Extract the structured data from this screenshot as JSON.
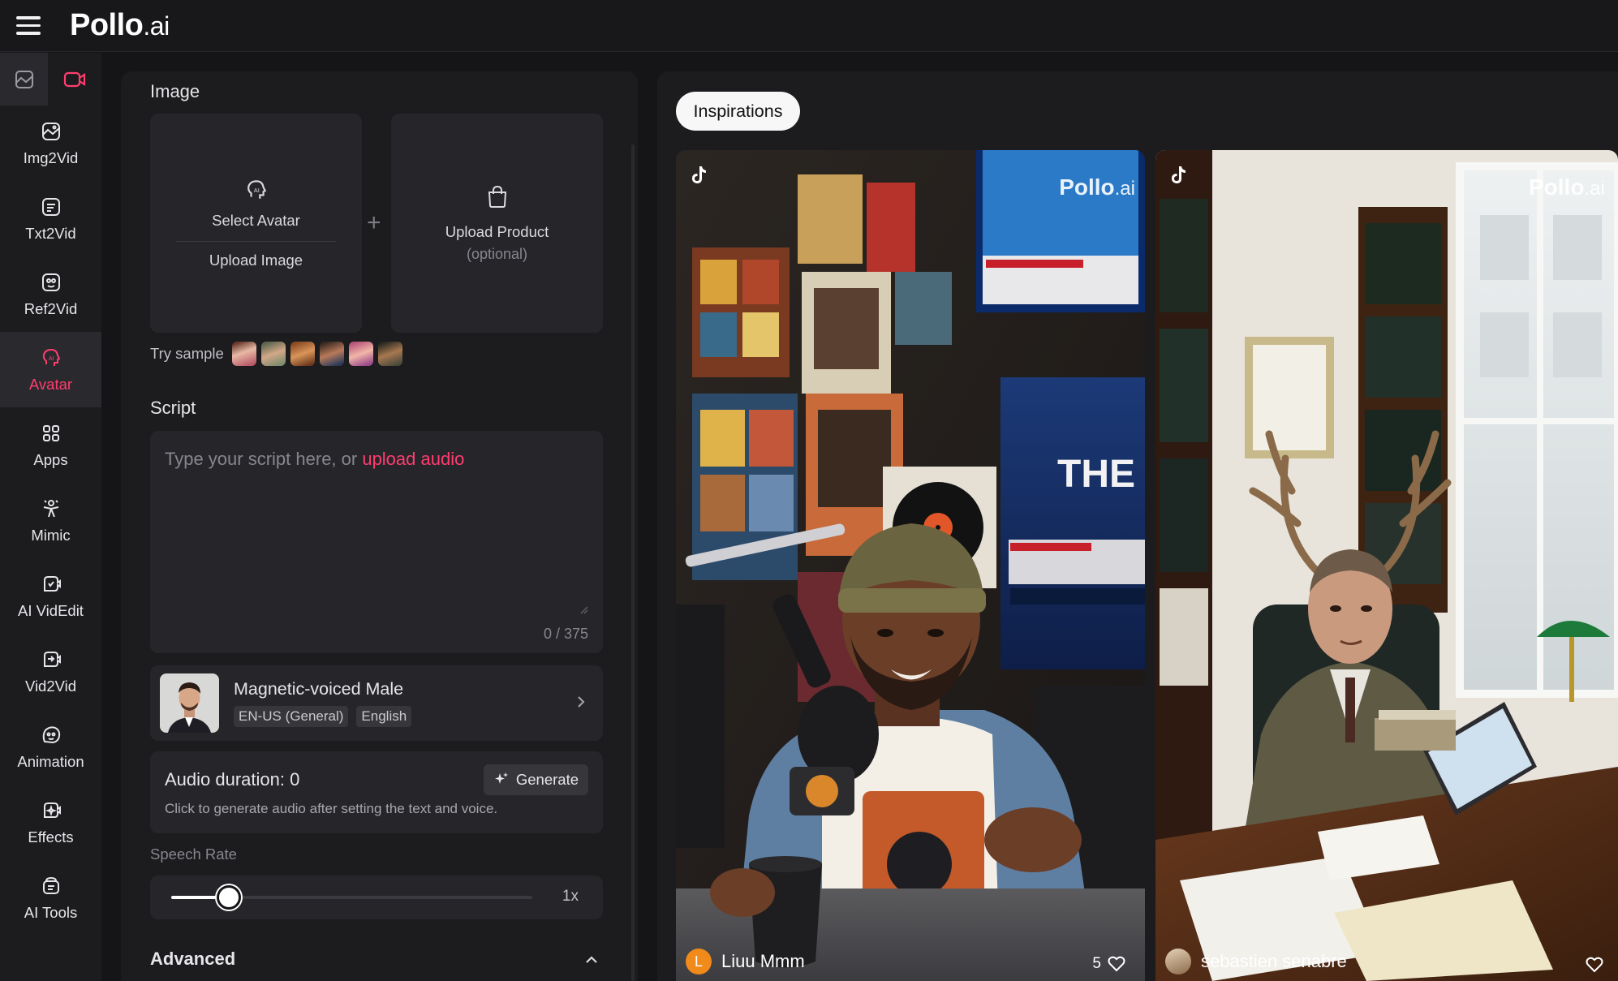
{
  "header": {
    "logo_main": "Pollo",
    "logo_suffix": ".ai"
  },
  "sidebar": {
    "items": [
      {
        "label": "Img2Vid",
        "icon": "image-to-video-icon"
      },
      {
        "label": "Txt2Vid",
        "icon": "text-to-video-icon"
      },
      {
        "label": "Ref2Vid",
        "icon": "reference-to-video-icon"
      },
      {
        "label": "Avatar",
        "icon": "avatar-icon",
        "active": true
      },
      {
        "label": "Apps",
        "icon": "apps-icon"
      },
      {
        "label": "Mimic",
        "icon": "mimic-icon"
      },
      {
        "label": "AI VidEdit",
        "icon": "video-edit-icon"
      },
      {
        "label": "Vid2Vid",
        "icon": "video-to-video-icon"
      },
      {
        "label": "Animation",
        "icon": "animation-icon"
      },
      {
        "label": "Effects",
        "icon": "effects-icon"
      },
      {
        "label": "AI Tools",
        "icon": "ai-tools-icon"
      }
    ]
  },
  "image_section": {
    "title": "Image",
    "select_avatar": "Select Avatar",
    "upload_image": "Upload Image",
    "upload_product": "Upload Product",
    "upload_product_sub": "(optional)",
    "try_sample": "Try sample"
  },
  "script_section": {
    "title": "Script",
    "placeholder": "Type your script here, or ",
    "upload_link": "upload audio",
    "counter": "0 / 375"
  },
  "voice": {
    "name": "Magnetic-voiced Male",
    "tags": [
      "EN-US (General)",
      "English"
    ]
  },
  "audio": {
    "duration_label": "Audio duration: 0",
    "hint": "Click to generate audio after setting the text and voice.",
    "generate_label": "Generate"
  },
  "speech_rate": {
    "label": "Speech Rate",
    "value_label": "1x",
    "level": 0.16
  },
  "advanced": {
    "label": "Advanced"
  },
  "gallery": {
    "tab_label": "Inspirations",
    "watermark_main": "Pollo",
    "watermark_suffix": ".ai",
    "cards": [
      {
        "author": "Liuu Mmm",
        "avatar_initial": "L",
        "likes": "5"
      },
      {
        "author": "sebastien senabre",
        "likes": ""
      }
    ]
  },
  "colors": {
    "accent": "#ff3d6f",
    "background": "#151517",
    "panel": "#1c1c1f",
    "card": "#26262a"
  }
}
